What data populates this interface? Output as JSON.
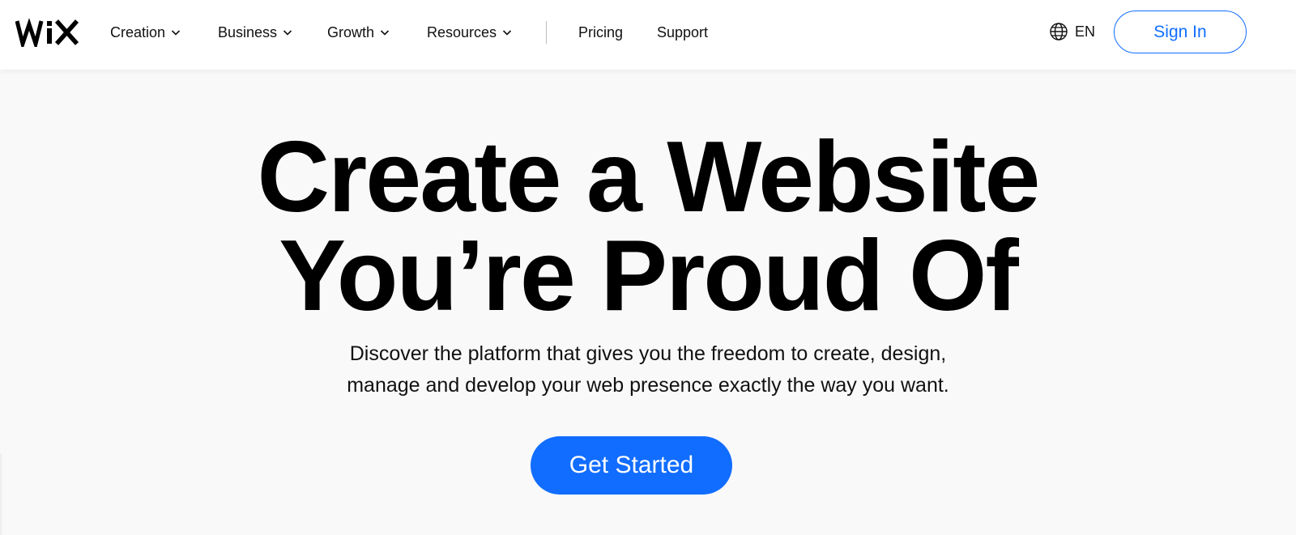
{
  "header": {
    "logo_text": "WiX",
    "nav": [
      {
        "label": "Creation",
        "has_dropdown": true
      },
      {
        "label": "Business",
        "has_dropdown": true
      },
      {
        "label": "Growth",
        "has_dropdown": true
      },
      {
        "label": "Resources",
        "has_dropdown": true
      },
      {
        "label": "Pricing",
        "has_dropdown": false
      },
      {
        "label": "Support",
        "has_dropdown": false
      }
    ],
    "language": {
      "icon": "globe-icon",
      "label": "EN"
    },
    "signin_label": "Sign In"
  },
  "hero": {
    "headline_line1": "Create a Website",
    "headline_line2": "You’re Proud Of",
    "subtitle_line1": "Discover the platform that gives you the freedom to create, design,",
    "subtitle_line2": "manage and develop your web presence exactly the way you want.",
    "cta_label": "Get Started"
  },
  "colors": {
    "accent": "#116dff",
    "header_bg": "#ffffff",
    "hero_bg": "#f9f9f9",
    "text": "#000000"
  }
}
